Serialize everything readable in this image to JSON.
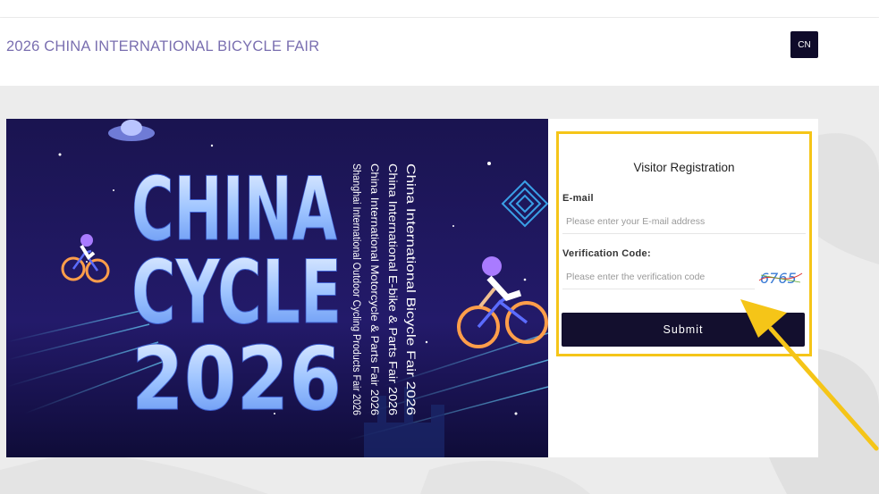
{
  "header": {
    "title": "2026 CHINA INTERNATIONAL BICYCLE FAIR",
    "lang_button": "CN"
  },
  "banner": {
    "logo_lines": [
      "CHINA",
      "CYCLE",
      "2026"
    ],
    "fair_names": [
      "China International Bicycle Fair 2026",
      "China International E-bike & Parts Fair 2026",
      "China International Motorcycle & Parts Fair 2026",
      "Shanghai International Outdoor Cycling Products Fair 2026"
    ]
  },
  "form": {
    "title": "Visitor Registration",
    "email_label": "E-mail",
    "email_placeholder": "Please enter your E-mail address",
    "email_value": "",
    "code_label": "Verification Code:",
    "code_placeholder": "Please enter the verification code",
    "code_value": "",
    "captcha_text": "6765",
    "submit_label": "Submit"
  },
  "colors": {
    "accent_highlight": "#f5c518",
    "dark_button": "#130f2e",
    "title_color": "#7a6fb0"
  }
}
